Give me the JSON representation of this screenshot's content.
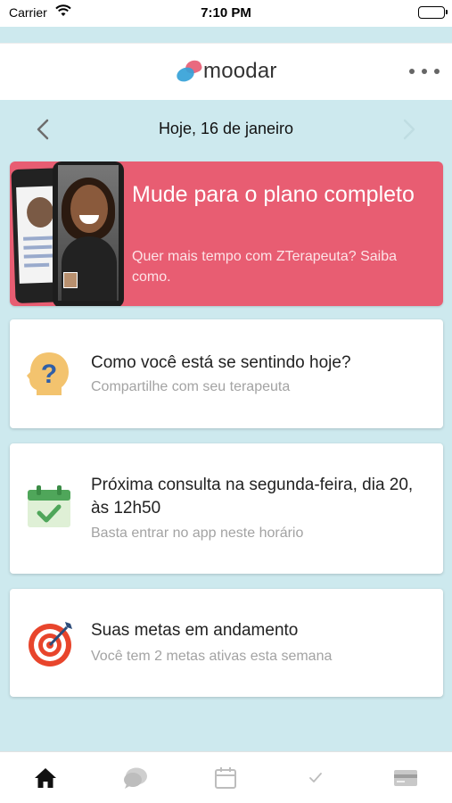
{
  "status_bar": {
    "carrier": "Carrier",
    "time": "7:10 PM"
  },
  "header": {
    "logo_text": "moodar"
  },
  "date_nav": {
    "date": "Hoje, 16 de janeiro"
  },
  "promo": {
    "title": "Mude para o plano completo",
    "subtitle": "Quer mais tempo com ZTerapeuta? Saiba como.",
    "background_color": "#e85d72"
  },
  "cards": [
    {
      "icon": "question-head-icon",
      "title": "Como você está se sentindo hoje?",
      "subtitle": "Compartilhe com seu terapeuta"
    },
    {
      "icon": "calendar-check-icon",
      "title": "Próxima consulta na segunda-feira, dia 20, às 12h50",
      "subtitle": "Basta entrar no app neste horário"
    },
    {
      "icon": "target-icon",
      "title": "Suas metas em andamento",
      "subtitle": "Você tem 2 metas ativas esta semana"
    }
  ],
  "tabs": [
    {
      "icon": "home-icon",
      "active": true
    },
    {
      "icon": "chat-icon",
      "active": false
    },
    {
      "icon": "calendar-icon",
      "active": false
    },
    {
      "icon": "checkmark-icon",
      "active": false
    },
    {
      "icon": "card-icon",
      "active": false
    }
  ],
  "colors": {
    "background": "#cde9ee",
    "accent_pink": "#e85d72",
    "logo_blue": "#35a2d8"
  }
}
